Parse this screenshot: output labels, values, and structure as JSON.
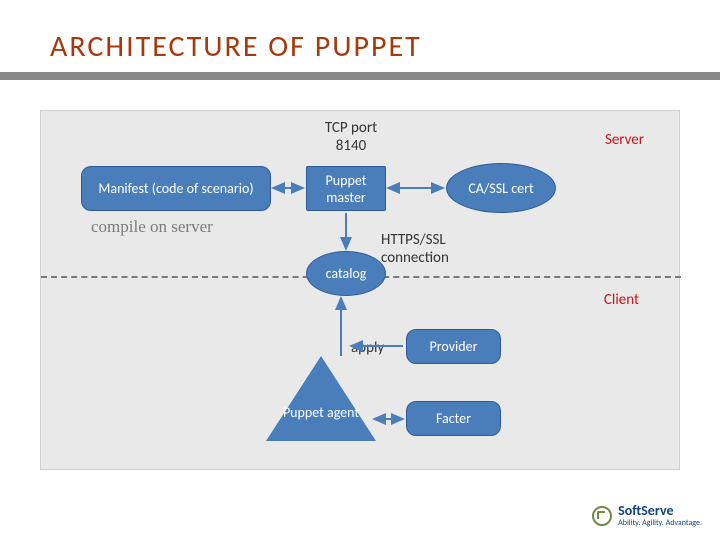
{
  "title": "ARCHITECTURE OF PUPPET",
  "labels": {
    "tcp_port": "TCP port 8140",
    "server": "Server",
    "client": "Client",
    "compile": "compile on server",
    "https": "HTTPS/SSL connection",
    "apply": "apply"
  },
  "nodes": {
    "manifest": "Manifest (code of scenario)",
    "puppet_master": "Puppet master",
    "ca_ssl": "CA/SSL cert",
    "catalog": "catalog",
    "provider": "Provider",
    "facter": "Facter",
    "puppet_agent": "Puppet agent"
  },
  "logo": {
    "name": "SoftServe",
    "tagline": "Ability. Agility. Advantage."
  },
  "colors": {
    "node_fill": "#4a7ebb",
    "title": "#a63a0f",
    "accent_red": "#c4181c",
    "bg_panel": "#e9e9e9"
  }
}
